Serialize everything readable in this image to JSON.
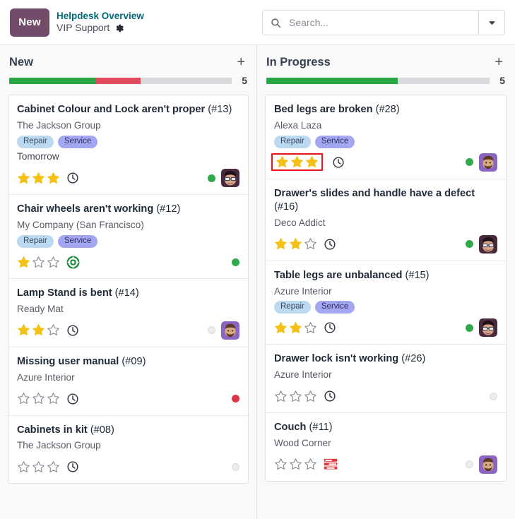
{
  "header": {
    "badge_label": "New",
    "breadcrumb_top": "Helpdesk Overview",
    "breadcrumb_sub": "VIP Support",
    "gear_icon": "gear-icon"
  },
  "search": {
    "placeholder": "Search...",
    "value": "",
    "search_icon": "search-icon",
    "caret_icon": "chevron-down-icon"
  },
  "columns": [
    {
      "title": "New",
      "count": "5",
      "add_label": "+",
      "progress": {
        "green_pct": 39,
        "red_pct": 20,
        "gray_pct": 41
      },
      "cards": [
        {
          "title": "Cabinet Colour and Lock aren't proper",
          "ref": "(#13)",
          "subtitle": "The Jackson Group",
          "tags": [
            "Repair",
            "Service"
          ],
          "date": "Tomorrow",
          "stars": 3,
          "stars_highlighted": false,
          "activity_icon": "clock-icon",
          "status_dot": "green",
          "avatar": "glasses-avatar"
        },
        {
          "title": "Chair wheels aren't working",
          "ref": "(#12)",
          "subtitle": "My Company (San Francisco)",
          "tags": [
            "Repair",
            "Service"
          ],
          "date": "",
          "stars": 1,
          "stars_highlighted": false,
          "activity_icon": "lifebuoy-icon",
          "status_dot": "green",
          "avatar": ""
        },
        {
          "title": "Lamp Stand is bent",
          "ref": "(#14)",
          "subtitle": "Ready Mat",
          "tags": [],
          "date": "",
          "stars": 2,
          "stars_highlighted": false,
          "activity_icon": "clock-icon",
          "status_dot": "gray",
          "avatar": "beard-avatar"
        },
        {
          "title": "Missing user manual",
          "ref": "(#09)",
          "subtitle": "Azure Interior",
          "tags": [],
          "date": "",
          "stars": 0,
          "stars_highlighted": false,
          "activity_icon": "clock-icon",
          "status_dot": "red",
          "avatar": ""
        },
        {
          "title": "Cabinets in kit",
          "ref": "(#08)",
          "subtitle": "The Jackson Group",
          "tags": [],
          "date": "",
          "stars": 0,
          "stars_highlighted": false,
          "activity_icon": "clock-icon",
          "status_dot": "gray",
          "avatar": ""
        }
      ]
    },
    {
      "title": "In Progress",
      "count": "5",
      "add_label": "+",
      "progress": {
        "green_pct": 59,
        "red_pct": 0,
        "gray_pct": 41
      },
      "cards": [
        {
          "title": "Bed legs are broken",
          "ref": "(#28)",
          "subtitle": "Alexa Laza",
          "tags": [
            "Repair",
            "Service"
          ],
          "date": "",
          "stars": 3,
          "stars_highlighted": true,
          "activity_icon": "clock-icon",
          "status_dot": "green",
          "avatar": "beard-avatar"
        },
        {
          "title": "Drawer's slides and handle have a defect",
          "ref": "(#16)",
          "subtitle": "Deco Addict",
          "tags": [],
          "date": "",
          "stars": 2,
          "stars_highlighted": false,
          "activity_icon": "clock-icon",
          "status_dot": "green",
          "avatar": "glasses-avatar"
        },
        {
          "title": "Table legs are unbalanced",
          "ref": "(#15)",
          "subtitle": "Azure Interior",
          "tags": [
            "Repair",
            "Service"
          ],
          "date": "",
          "stars": 2,
          "stars_highlighted": false,
          "activity_icon": "clock-icon",
          "status_dot": "green",
          "avatar": "glasses-avatar"
        },
        {
          "title": "Drawer lock isn't working",
          "ref": "(#26)",
          "subtitle": "Azure Interior",
          "tags": [],
          "date": "",
          "stars": 0,
          "stars_highlighted": false,
          "activity_icon": "clock-icon",
          "status_dot": "gray",
          "avatar": ""
        },
        {
          "title": "Couch",
          "ref": "(#11)",
          "subtitle": "Wood Corner",
          "tags": [],
          "date": "",
          "stars": 0,
          "stars_highlighted": false,
          "activity_icon": "late-bars-icon",
          "status_dot": "gray",
          "avatar": "beard-avatar"
        }
      ]
    }
  ],
  "colors": {
    "brand": "#714b67",
    "link": "#00697a",
    "green": "#28a745",
    "red": "#e04c5d",
    "star": "#f5c116",
    "highlight_box": "#e8151a",
    "tag_repair_bg": "#bcd9f2",
    "tag_service_bg": "#a3a6f0"
  }
}
